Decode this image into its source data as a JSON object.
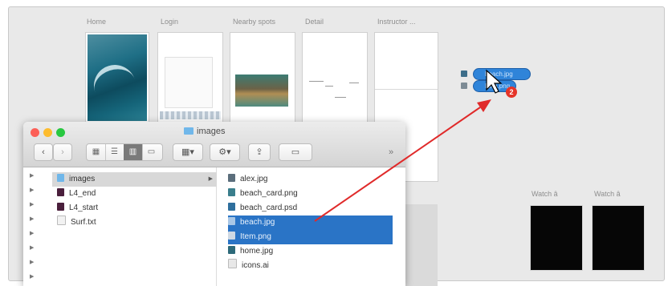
{
  "xd": {
    "artboards": [
      {
        "id": "home",
        "label": "Home"
      },
      {
        "id": "login",
        "label": "Login"
      },
      {
        "id": "nearby",
        "label": "Nearby spots"
      },
      {
        "id": "detail",
        "label": "Detail"
      },
      {
        "id": "instructor",
        "label": "Instructor ..."
      }
    ],
    "watch_labels": [
      "Watch â",
      "Watch â"
    ],
    "layers": [
      {
        "label": "beach.jpg",
        "icon": "image-layer-icon"
      },
      {
        "label": "Item.png",
        "icon": "text-layer-icon"
      }
    ],
    "drag_count": "2",
    "colors": {
      "selection": "#2a74c6",
      "pill": "#2f84d9",
      "badge": "#e53529",
      "arrow": "#e02a2a"
    }
  },
  "finder": {
    "title": "images",
    "toolbar": {
      "back": "‹",
      "forward": "›",
      "more": "»"
    },
    "sidebar_items": [
      {
        "label": "images",
        "icon": "folder-icon"
      },
      {
        "label": "L4_end",
        "icon": "xd-file-icon"
      },
      {
        "label": "L4_start",
        "icon": "xd-file-icon"
      },
      {
        "label": "Surf.txt",
        "icon": "text-file-icon"
      }
    ],
    "files": [
      {
        "label": "alex.jpg",
        "selected": false
      },
      {
        "label": "beach_card.png",
        "selected": false
      },
      {
        "label": "beach_card.psd",
        "selected": false
      },
      {
        "label": "beach.jpg",
        "selected": true
      },
      {
        "label": "Item.png",
        "selected": true
      },
      {
        "label": "home.jpg",
        "selected": false
      },
      {
        "label": "icons.ai",
        "selected": false
      }
    ]
  }
}
